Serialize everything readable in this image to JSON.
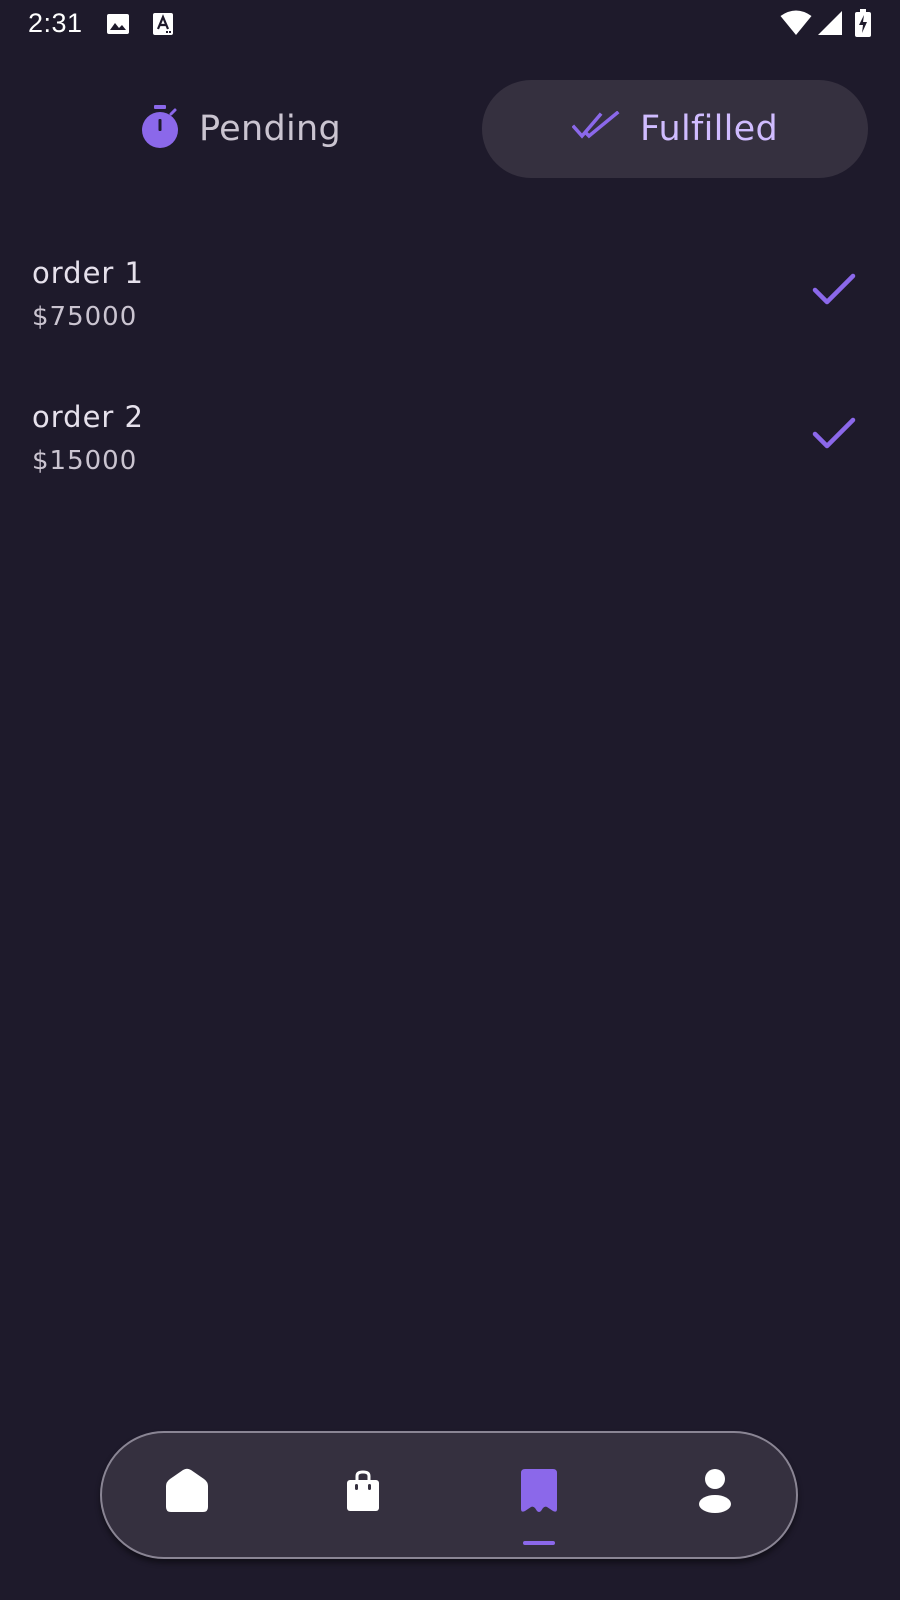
{
  "status_bar": {
    "time": "2:31",
    "left_icons": [
      "image-icon",
      "text-a-icon"
    ],
    "right_icons": [
      "wifi-icon",
      "cellular-signal-icon",
      "battery-charging-icon"
    ]
  },
  "tabs": [
    {
      "label": "Pending",
      "icon": "timer-icon",
      "selected": false
    },
    {
      "label": "Fulfilled",
      "icon": "double-check-icon",
      "selected": true
    }
  ],
  "orders": [
    {
      "name": "order 1",
      "price": "$75000",
      "status_icon": "check-icon"
    },
    {
      "name": "order 2",
      "price": "$15000",
      "status_icon": "check-icon"
    }
  ],
  "bottom_nav": {
    "items": [
      {
        "icon": "home-icon",
        "selected": false
      },
      {
        "icon": "shopping-bag-icon",
        "selected": false
      },
      {
        "icon": "bookmark-icon",
        "selected": true
      },
      {
        "icon": "person-icon",
        "selected": false
      }
    ]
  },
  "colors": {
    "background": "#1e1a2b",
    "surface": "#35303f",
    "accent": "#8b68ea",
    "accent_text": "#d0bcff",
    "text_primary": "#e6e1ec",
    "text_secondary": "#cac4d0"
  }
}
